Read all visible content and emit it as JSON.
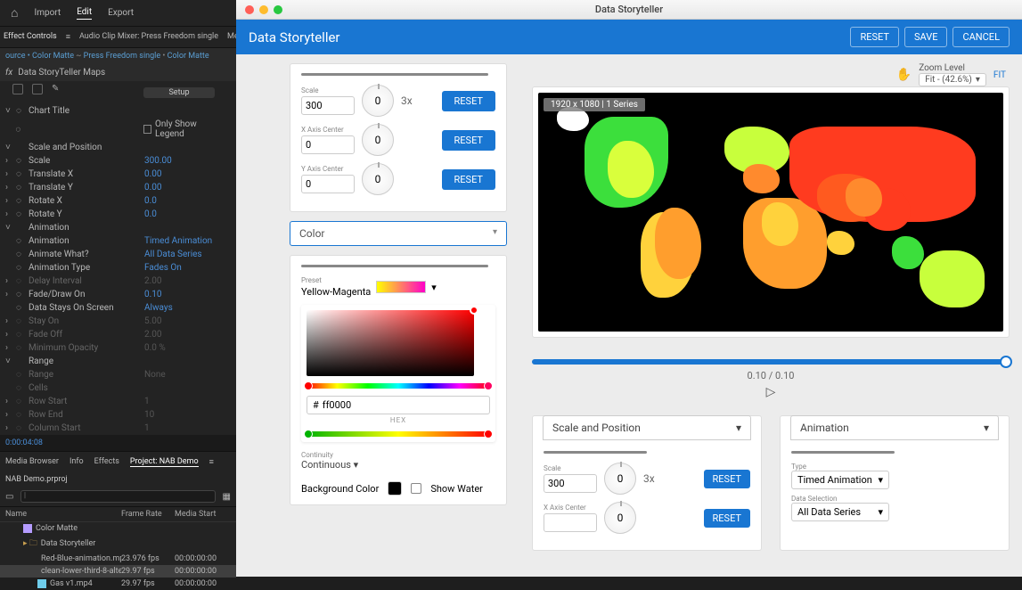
{
  "ae": {
    "menu": {
      "import": "Import",
      "edit": "Edit",
      "export": "Export"
    },
    "tabs": {
      "effect_controls": "Effect Controls",
      "hamburger": "≡",
      "audio_mixer": "Audio Clip Mixer: Press Freedom single",
      "metadata": "Metadata"
    },
    "breadcrumb": {
      "a": "ource • Color Matte",
      "sep1": "~",
      "b": "Press Freedom single",
      "sep2": "•",
      "c": "Color Matte"
    },
    "fx_title": "Data StoryTeller Maps",
    "setup": "Setup",
    "chart_title": "Chart Title",
    "only_show_legend": "Only Show Legend",
    "section_scale": "Scale and Position",
    "props": {
      "scale": {
        "label": "Scale",
        "val": "300.00"
      },
      "tx": {
        "label": "Translate X",
        "val": "0.00"
      },
      "ty": {
        "label": "Translate Y",
        "val": "0.00"
      },
      "rx": {
        "label": "Rotate X",
        "val": "0.0"
      },
      "ry": {
        "label": "Rotate Y",
        "val": "0.0"
      }
    },
    "section_anim": "Animation",
    "anim": {
      "animation": {
        "label": "Animation",
        "val": "Timed Animation"
      },
      "what": {
        "label": "Animate What?",
        "val": "All Data Series"
      },
      "type": {
        "label": "Animation Type",
        "val": "Fades On"
      },
      "delay": {
        "label": "Delay Interval",
        "val": "2.00"
      },
      "fade": {
        "label": "Fade/Draw On",
        "val": "0.10"
      },
      "stays": {
        "label": "Data Stays On Screen",
        "val": "Always"
      },
      "stayon": {
        "label": "Stay On",
        "val": "5.00"
      },
      "fadeoff": {
        "label": "Fade Off",
        "val": "2.00"
      },
      "minop": {
        "label": "Minimum Opacity",
        "val": "0.0 %"
      }
    },
    "range": {
      "label": "Range",
      "range": "Range",
      "range_val": "None",
      "cells": "Cells",
      "rowstart": "Row Start",
      "rowstart_v": "1",
      "rowend": "Row End",
      "rowend_v": "10",
      "colstart": "Column Start",
      "colstart_v": "1"
    },
    "timecode": "0:00:04:08",
    "lower_tabs": {
      "media": "Media Browser",
      "info": "Info",
      "effects": "Effects",
      "project": "Project: NAB Demo"
    },
    "projname": "NAB Demo.prproj",
    "filecols": {
      "name": "Name",
      "fps": "Frame Rate",
      "start": "Media Start"
    },
    "files": {
      "colormatte": "Color Matte",
      "folder": "Data Storyteller",
      "f1": {
        "name": "Red-Blue-animation.mp",
        "fps": "23.976 fps",
        "start": "00:00:00:00"
      },
      "f2": {
        "name": "clean-lower-third-8-alte",
        "fps": "29.97 fps",
        "start": "00:00:00:00"
      },
      "f3": {
        "name": "Gas v1.mp4",
        "fps": "29.97 fps",
        "start": "00:00:00:00"
      }
    }
  },
  "ds": {
    "window_title": "Data Storyteller",
    "header_title": "Data Storyteller",
    "buttons": {
      "reset": "RESET",
      "save": "SAVE",
      "cancel": "CANCEL"
    },
    "scale_card": {
      "scale": {
        "label": "Scale",
        "value": "300",
        "knob": "0",
        "mult": "3x",
        "reset": "RESET"
      },
      "xcenter": {
        "label": "X Axis Center",
        "value": "0",
        "knob": "0",
        "reset": "RESET"
      },
      "ycenter": {
        "label": "Y Axis Center",
        "value": "0",
        "knob": "0",
        "reset": "RESET"
      }
    },
    "color_dd": "Color",
    "color_card": {
      "preset_label": "Preset",
      "preset": "Yellow-Magenta",
      "hex": "ff0000",
      "hex_label": "HEX",
      "continuity_label": "Continuity",
      "continuity": "Continuous",
      "bg_label": "Background Color",
      "show_water": "Show Water"
    },
    "zoom": {
      "label": "Zoom Level",
      "value": "Fit - (42.6%)",
      "fit": "FIT"
    },
    "map_badge": "1920 x 1080 | 1 Series",
    "timeline": {
      "time": "0.10 / 0.10"
    },
    "bottom": {
      "scale_dd": "Scale and Position",
      "anim_dd": "Animation",
      "scale": {
        "label": "Scale",
        "value": "300",
        "knob": "0",
        "mult": "3x",
        "reset": "RESET"
      },
      "xcenter": {
        "label": "X Axis Center",
        "knob": "0",
        "reset": "RESET"
      },
      "type_label": "Type",
      "type": "Timed Animation",
      "datasel_label": "Data Selection",
      "datasel": "All Data Series"
    }
  }
}
